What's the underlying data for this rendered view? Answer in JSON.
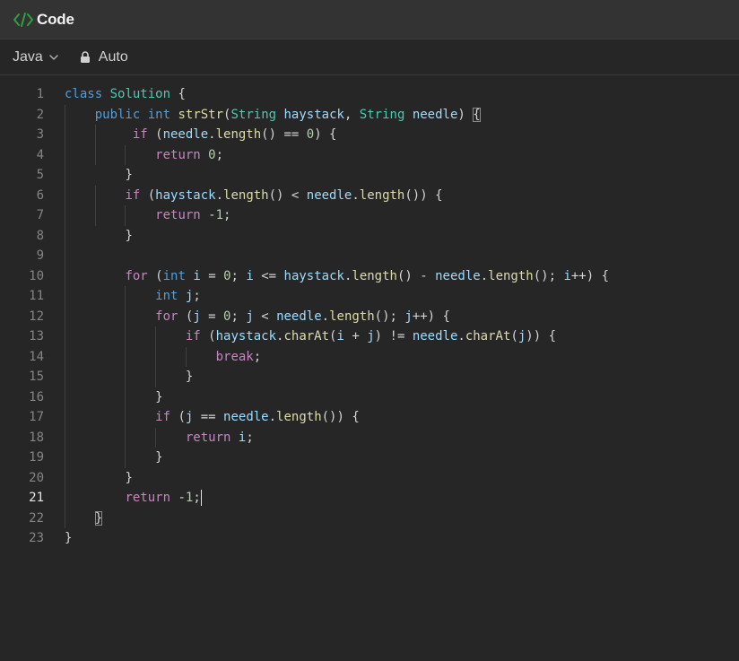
{
  "window": {
    "title": "Code"
  },
  "toolbar": {
    "language": "Java",
    "mode": "Auto"
  },
  "icons": {
    "title": "code-brackets-icon",
    "language_dropdown": "chevron-down-icon",
    "mode": "lock-icon"
  },
  "colors": {
    "title_icon": "#2ea043",
    "keyword_control": "#c586c0",
    "keyword_type": "#569cd6",
    "class_type": "#4ec9b0",
    "function": "#dcdcaa",
    "variable": "#9cdcfe",
    "number": "#b5cea8"
  },
  "editor": {
    "active_line": 21,
    "lines": [
      {
        "n": "1",
        "indent": 0,
        "tokens": [
          [
            "kt",
            "class"
          ],
          [
            "pn",
            " "
          ],
          [
            "ty",
            "Solution"
          ],
          [
            "pn",
            " {"
          ]
        ]
      },
      {
        "n": "2",
        "indent": 4,
        "tokens": [
          [
            "kt",
            "public"
          ],
          [
            "pn",
            " "
          ],
          [
            "kt",
            "int"
          ],
          [
            "pn",
            " "
          ],
          [
            "fn",
            "strStr"
          ],
          [
            "pn",
            "("
          ],
          [
            "ty",
            "String"
          ],
          [
            "pn",
            " "
          ],
          [
            "var",
            "haystack"
          ],
          [
            "pn",
            ", "
          ],
          [
            "ty",
            "String"
          ],
          [
            "pn",
            " "
          ],
          [
            "var",
            "needle"
          ],
          [
            "pn",
            ") "
          ],
          [
            "hl",
            "{"
          ]
        ]
      },
      {
        "n": "3",
        "indent": 9,
        "tokens": [
          [
            "kw",
            "if"
          ],
          [
            "pn",
            " ("
          ],
          [
            "var",
            "needle"
          ],
          [
            "pn",
            "."
          ],
          [
            "fn",
            "length"
          ],
          [
            "pn",
            "() == "
          ],
          [
            "num",
            "0"
          ],
          [
            "pn",
            ") {"
          ]
        ]
      },
      {
        "n": "4",
        "indent": 12,
        "tokens": [
          [
            "kw",
            "return"
          ],
          [
            "pn",
            " "
          ],
          [
            "num",
            "0"
          ],
          [
            "pn",
            ";"
          ]
        ]
      },
      {
        "n": "5",
        "indent": 8,
        "tokens": [
          [
            "pn",
            "}"
          ]
        ]
      },
      {
        "n": "6",
        "indent": 8,
        "tokens": [
          [
            "kw",
            "if"
          ],
          [
            "pn",
            " ("
          ],
          [
            "var",
            "haystack"
          ],
          [
            "pn",
            "."
          ],
          [
            "fn",
            "length"
          ],
          [
            "pn",
            "() < "
          ],
          [
            "var",
            "needle"
          ],
          [
            "pn",
            "."
          ],
          [
            "fn",
            "length"
          ],
          [
            "pn",
            "()) {"
          ]
        ]
      },
      {
        "n": "7",
        "indent": 12,
        "tokens": [
          [
            "kw",
            "return"
          ],
          [
            "pn",
            " -"
          ],
          [
            "num",
            "1"
          ],
          [
            "pn",
            ";"
          ]
        ]
      },
      {
        "n": "8",
        "indent": 8,
        "tokens": [
          [
            "pn",
            "}"
          ]
        ]
      },
      {
        "n": "9",
        "indent": 0,
        "tokens": []
      },
      {
        "n": "10",
        "indent": 8,
        "tokens": [
          [
            "kw",
            "for"
          ],
          [
            "pn",
            " ("
          ],
          [
            "kt",
            "int"
          ],
          [
            "pn",
            " "
          ],
          [
            "var",
            "i"
          ],
          [
            "pn",
            " = "
          ],
          [
            "num",
            "0"
          ],
          [
            "pn",
            "; "
          ],
          [
            "var",
            "i"
          ],
          [
            "pn",
            " <= "
          ],
          [
            "var",
            "haystack"
          ],
          [
            "pn",
            "."
          ],
          [
            "fn",
            "length"
          ],
          [
            "pn",
            "() - "
          ],
          [
            "var",
            "needle"
          ],
          [
            "pn",
            "."
          ],
          [
            "fn",
            "length"
          ],
          [
            "pn",
            "(); "
          ],
          [
            "var",
            "i"
          ],
          [
            "pn",
            "++) {"
          ]
        ]
      },
      {
        "n": "11",
        "indent": 12,
        "tokens": [
          [
            "kt",
            "int"
          ],
          [
            "pn",
            " "
          ],
          [
            "var",
            "j"
          ],
          [
            "pn",
            ";"
          ]
        ]
      },
      {
        "n": "12",
        "indent": 12,
        "tokens": [
          [
            "kw",
            "for"
          ],
          [
            "pn",
            " ("
          ],
          [
            "var",
            "j"
          ],
          [
            "pn",
            " = "
          ],
          [
            "num",
            "0"
          ],
          [
            "pn",
            "; "
          ],
          [
            "var",
            "j"
          ],
          [
            "pn",
            " < "
          ],
          [
            "var",
            "needle"
          ],
          [
            "pn",
            "."
          ],
          [
            "fn",
            "length"
          ],
          [
            "pn",
            "(); "
          ],
          [
            "var",
            "j"
          ],
          [
            "pn",
            "++) {"
          ]
        ]
      },
      {
        "n": "13",
        "indent": 16,
        "tokens": [
          [
            "kw",
            "if"
          ],
          [
            "pn",
            " ("
          ],
          [
            "var",
            "haystack"
          ],
          [
            "pn",
            "."
          ],
          [
            "fn",
            "charAt"
          ],
          [
            "pn",
            "("
          ],
          [
            "var",
            "i"
          ],
          [
            "pn",
            " + "
          ],
          [
            "var",
            "j"
          ],
          [
            "pn",
            ") != "
          ],
          [
            "var",
            "needle"
          ],
          [
            "pn",
            "."
          ],
          [
            "fn",
            "charAt"
          ],
          [
            "pn",
            "("
          ],
          [
            "var",
            "j"
          ],
          [
            "pn",
            ")) {"
          ]
        ]
      },
      {
        "n": "14",
        "indent": 20,
        "tokens": [
          [
            "kw",
            "break"
          ],
          [
            "pn",
            ";"
          ]
        ]
      },
      {
        "n": "15",
        "indent": 16,
        "tokens": [
          [
            "pn",
            "}"
          ]
        ]
      },
      {
        "n": "16",
        "indent": 12,
        "tokens": [
          [
            "pn",
            "}"
          ]
        ]
      },
      {
        "n": "17",
        "indent": 12,
        "tokens": [
          [
            "kw",
            "if"
          ],
          [
            "pn",
            " ("
          ],
          [
            "var",
            "j"
          ],
          [
            "pn",
            " == "
          ],
          [
            "var",
            "needle"
          ],
          [
            "pn",
            "."
          ],
          [
            "fn",
            "length"
          ],
          [
            "pn",
            "()) {"
          ]
        ]
      },
      {
        "n": "18",
        "indent": 16,
        "tokens": [
          [
            "kw",
            "return"
          ],
          [
            "pn",
            " "
          ],
          [
            "var",
            "i"
          ],
          [
            "pn",
            ";"
          ]
        ]
      },
      {
        "n": "19",
        "indent": 12,
        "tokens": [
          [
            "pn",
            "}"
          ]
        ]
      },
      {
        "n": "20",
        "indent": 8,
        "tokens": [
          [
            "pn",
            "}"
          ]
        ]
      },
      {
        "n": "21",
        "indent": 8,
        "tokens": [
          [
            "kw",
            "return"
          ],
          [
            "pn",
            " -"
          ],
          [
            "num",
            "1"
          ],
          [
            "pn",
            ";"
          ],
          [
            "cursor",
            ""
          ]
        ]
      },
      {
        "n": "22",
        "indent": 4,
        "tokens": [
          [
            "hl",
            "}"
          ]
        ]
      },
      {
        "n": "23",
        "indent": 0,
        "tokens": [
          [
            "pn",
            "}"
          ]
        ]
      }
    ]
  }
}
